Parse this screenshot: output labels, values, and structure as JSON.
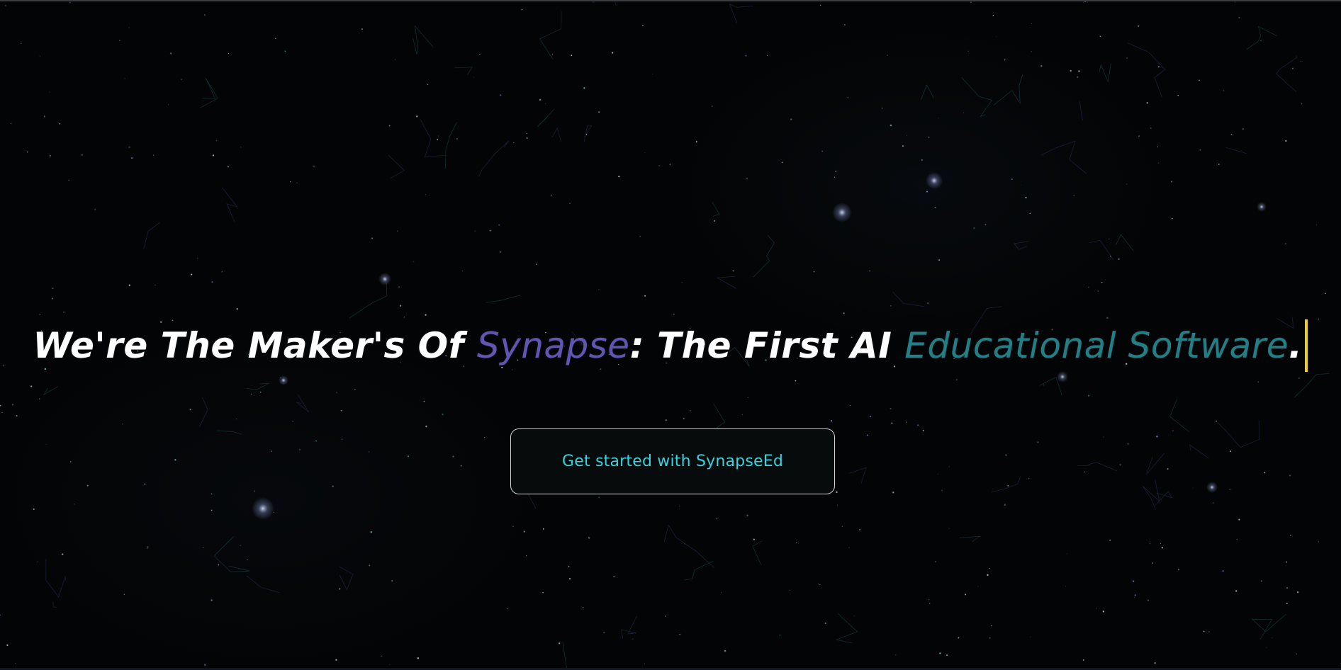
{
  "hero": {
    "headline_part1": "We're The Maker's Of ",
    "headline_brand": "Synapse",
    "headline_part2": ": The First AI ",
    "headline_accent": "Educational Software",
    "headline_end": "."
  },
  "cta": {
    "label": "Get started with SynapseEd"
  },
  "colors": {
    "background": "#030405",
    "headline_text": "#ffffff",
    "brand_word": "#5f55b3",
    "accent_words": "#237f86",
    "cursor": "#f1d21b",
    "cta_text": "#35d3e0",
    "cta_border": "#cfd3d8"
  }
}
